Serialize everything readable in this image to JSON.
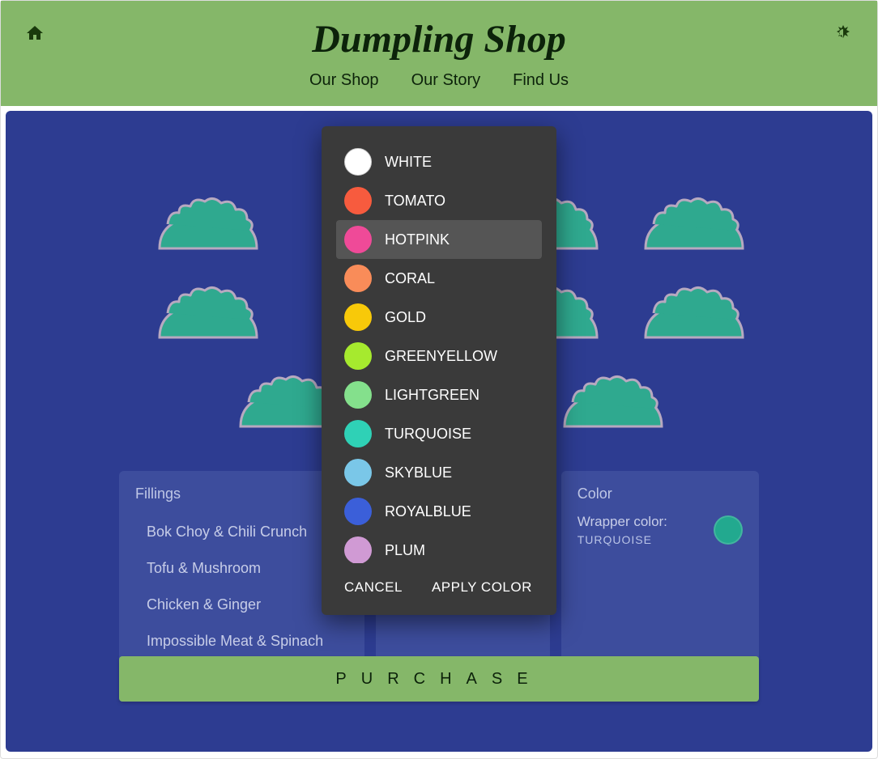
{
  "header": {
    "title": "Dumpling Shop",
    "nav": [
      "Our Shop",
      "Our Story",
      "Find Us"
    ]
  },
  "cards": {
    "fillings": {
      "title": "Fillings",
      "items": [
        "Bok Choy & Chili Crunch",
        "Tofu & Mushroom",
        "Chicken & Ginger",
        "Impossible Meat & Spinach"
      ]
    },
    "color": {
      "title": "Color",
      "wrapper_label": "Wrapper color:",
      "wrapper_value": "TURQUOISE",
      "swatch_color": "#22a98f"
    }
  },
  "purchase_label": "PURCHASE",
  "dialog": {
    "colors": [
      {
        "name": "WHITE",
        "hex": "#ffffff",
        "selected": false
      },
      {
        "name": "TOMATO",
        "hex": "#f75b3e",
        "selected": false
      },
      {
        "name": "HOTPINK",
        "hex": "#ef4a98",
        "selected": true
      },
      {
        "name": "CORAL",
        "hex": "#f98c59",
        "selected": false
      },
      {
        "name": "GOLD",
        "hex": "#f8c909",
        "selected": false
      },
      {
        "name": "GREENYELLOW",
        "hex": "#a6ea2e",
        "selected": false
      },
      {
        "name": "LIGHTGREEN",
        "hex": "#84e08c",
        "selected": false
      },
      {
        "name": "TURQUOISE",
        "hex": "#2fd1b6",
        "selected": false
      },
      {
        "name": "SKYBLUE",
        "hex": "#7ac7e8",
        "selected": false
      },
      {
        "name": "ROYALBLUE",
        "hex": "#3b5fd9",
        "selected": false
      },
      {
        "name": "PLUM",
        "hex": "#d09ad4",
        "selected": false
      }
    ],
    "cancel": "CANCEL",
    "apply": "APPLY COLOR"
  },
  "dumpling_color": "#2fa98f",
  "dumpling_outline": "#b7a9c0"
}
